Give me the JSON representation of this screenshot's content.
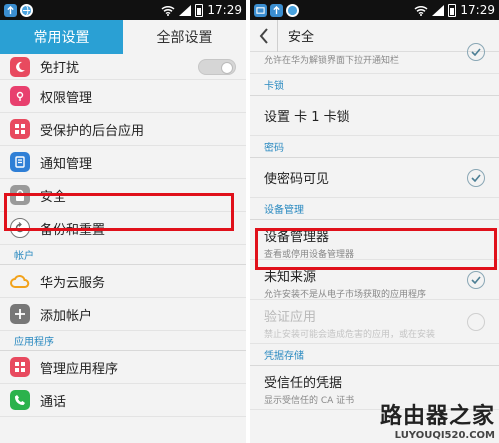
{
  "status_bar": {
    "time": "17:29"
  },
  "left": {
    "tabs": [
      {
        "label": "常用设置"
      },
      {
        "label": "全部设置"
      }
    ],
    "items": [
      {
        "label": "免打扰",
        "icon": "moon-icon",
        "color": "#e84a5f"
      },
      {
        "label": "权限管理",
        "icon": "shield-key-icon",
        "color": "#e8406e"
      },
      {
        "label": "受保护的后台应用",
        "icon": "grid-apps-icon",
        "color": "#e84a5f"
      },
      {
        "label": "通知管理",
        "icon": "notification-icon",
        "color": "#2f7fd6"
      },
      {
        "label": "安全",
        "icon": "lock-icon",
        "color": "#9a9a9a"
      },
      {
        "label": "备份和重置",
        "icon": "backup-icon",
        "color": "#777777"
      }
    ],
    "section_accounts": "帐户",
    "account_items": [
      {
        "label": "华为云服务",
        "icon": "cloud-icon",
        "color": "#f2a21b"
      },
      {
        "label": "添加帐户",
        "icon": "plus-icon",
        "color": "#777777"
      }
    ],
    "section_apps": "应用程序",
    "app_items": [
      {
        "label": "管理应用程序",
        "icon": "apps-icon",
        "color": "#e84a5f"
      },
      {
        "label": "通话",
        "icon": "phone-icon",
        "color": "#2bb24c"
      }
    ]
  },
  "right": {
    "title": "安全",
    "top_sub": "允许在华为解锁界面下拉开通知栏",
    "section_sim": "卡锁",
    "sim_lock": "设置 卡 1 卡锁",
    "section_password": "密码",
    "show_password": "使密码可见",
    "section_device": "设备管理",
    "device_admin": {
      "main": "设备管理器",
      "sub": "查看或停用设备管理器"
    },
    "unknown_sources": {
      "main": "未知来源",
      "sub": "允许安装不是从电子市场获取的应用程序"
    },
    "verify_apps": {
      "main": "验证应用",
      "sub": "禁止安装可能会造成危害的应用，或在安装"
    },
    "section_credentials": "凭据存储",
    "trusted_credentials": {
      "main": "受信任的凭据",
      "sub": "显示受信任的 CA 证书"
    }
  },
  "watermark": {
    "cn": "路由器之家",
    "en": "LUYOUQI520.COM"
  }
}
